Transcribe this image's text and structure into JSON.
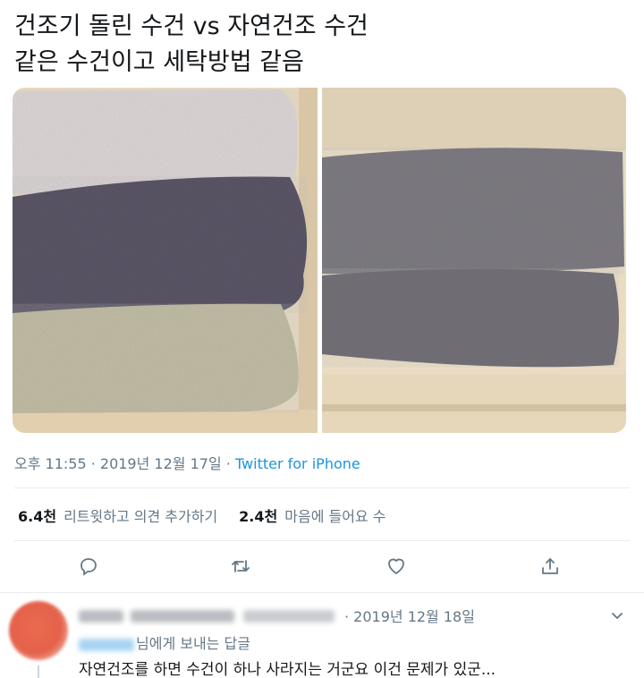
{
  "tweet": {
    "line1": "건조기 돌린 수건 vs 자연건조 수건",
    "line2": "같은 수건이고 세탁방법 같음"
  },
  "meta": {
    "datetime": "오후 11:55 · 2019년 12월 17일 · ",
    "source": "Twitter for iPhone"
  },
  "stats": {
    "retweets_count": "6.4천",
    "retweets_label": "리트윗하고 의견 추가하기",
    "likes_count": "2.4천",
    "likes_label": "마음에 들어요 수"
  },
  "actions": [
    "reply-icon",
    "retweet-icon",
    "like-icon",
    "share-icon"
  ],
  "reply": {
    "date": "· 2019년 12월 18일",
    "to_suffix": "님에게 보내는 답글",
    "text": "자연건조를 하면 수건이 하나 사라지는 거군요 이건 문제가 있군..."
  },
  "colors": {
    "accent": "#1b95e0",
    "muted_text": "#657786",
    "avatar": "#e4614a"
  }
}
